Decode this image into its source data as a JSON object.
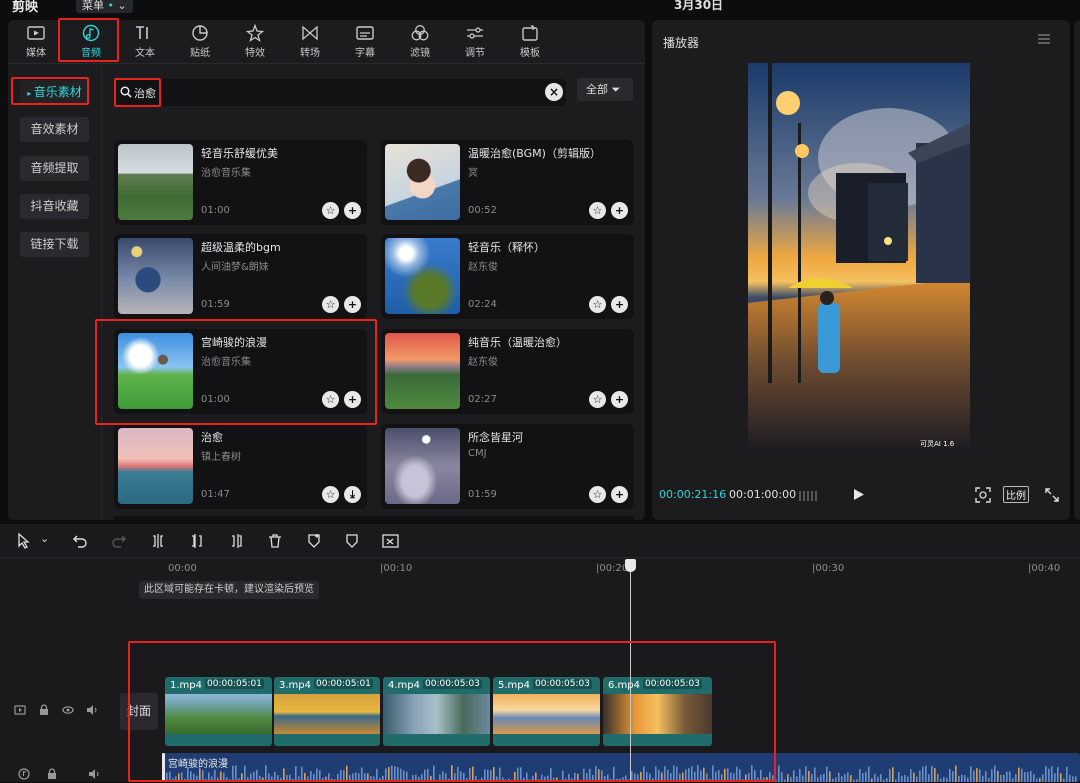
{
  "app": {
    "name": "剪映",
    "menu_label": "菜单",
    "date_label": "3月30日"
  },
  "toolbar": [
    {
      "label": "媒体",
      "icon": "media-icon"
    },
    {
      "label": "音频",
      "icon": "audio-icon",
      "active": true
    },
    {
      "label": "文本",
      "icon": "text-icon"
    },
    {
      "label": "贴纸",
      "icon": "sticker-icon"
    },
    {
      "label": "特效",
      "icon": "effects-icon"
    },
    {
      "label": "转场",
      "icon": "transition-icon"
    },
    {
      "label": "字幕",
      "icon": "subtitle-icon"
    },
    {
      "label": "滤镜",
      "icon": "filter-icon"
    },
    {
      "label": "调节",
      "icon": "adjust-icon"
    },
    {
      "label": "模板",
      "icon": "template-icon"
    }
  ],
  "categories": [
    {
      "label": "音乐素材",
      "active": true
    },
    {
      "label": "音效素材"
    },
    {
      "label": "音频提取"
    },
    {
      "label": "抖音收藏"
    },
    {
      "label": "链接下载"
    }
  ],
  "search": {
    "value": "治愈",
    "filter_label": "全部"
  },
  "tracks": [
    {
      "title": "轻音乐舒缓优美",
      "artist": "治愈音乐集",
      "duration": "01:00"
    },
    {
      "title": "温暖治愈(BGM)（剪辑版）",
      "artist": "冥",
      "duration": "00:52"
    },
    {
      "title": "超级温柔的bgm",
      "artist": "人间油梦&朗妹",
      "duration": "01:59"
    },
    {
      "title": "轻音乐（释怀）",
      "artist": "赵东俊",
      "duration": "02:24"
    },
    {
      "title": "宫崎骏的浪漫",
      "artist": "治愈音乐集",
      "duration": "01:00"
    },
    {
      "title": "纯音乐（温暖治愈）",
      "artist": "赵东俊",
      "duration": "02:27"
    },
    {
      "title": "治愈",
      "artist": "镇上春树",
      "duration": "01:47",
      "download": true
    },
    {
      "title": "所念皆星河",
      "artist": "CMJ",
      "duration": "01:59"
    }
  ],
  "player": {
    "title": "播放器",
    "current_time": "00:00:21:16",
    "total_time": "00:01:00:00",
    "ratio_label": "比例",
    "watermark": "可灵AI 1.6"
  },
  "timeline": {
    "ticks": [
      "00:00",
      "00:10",
      "00:20",
      "00:30",
      "00:40"
    ],
    "hint": "此区域可能存在卡顿，建议渲染后预览",
    "cover_label": "封面",
    "clips": [
      {
        "name": "1.mp4",
        "time": "00:00:05:01"
      },
      {
        "name": "3.mp4",
        "time": "00:00:05:01"
      },
      {
        "name": "4.mp4",
        "time": "00:00:05:03"
      },
      {
        "name": "5.mp4",
        "time": "00:00:05:03"
      },
      {
        "name": "6.mp4",
        "time": "00:00:05:03"
      }
    ],
    "audio_clip": "宫崎骏的浪漫"
  },
  "colors": {
    "accent": "#2ed6d8",
    "highlight": "#e8231b",
    "clip": "#1f6c6a",
    "audio": "#1f3d72"
  }
}
